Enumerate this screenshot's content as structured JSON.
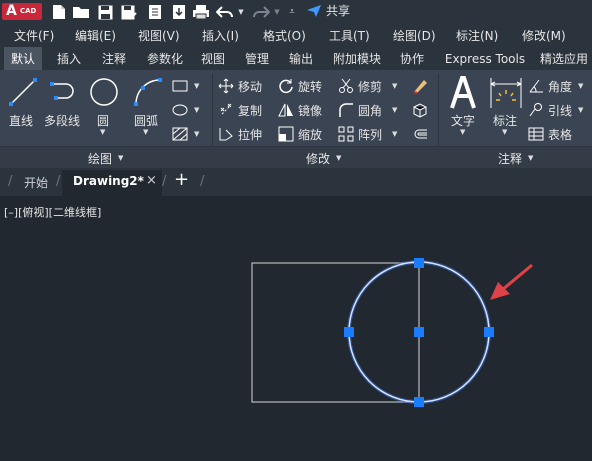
{
  "app": {
    "logo_letter": "A",
    "logo_sub": "CAD",
    "share_label": "共享"
  },
  "menu": [
    "文件(F)",
    "编辑(E)",
    "视图(V)",
    "插入(I)",
    "格式(O)",
    "工具(T)",
    "绘图(D)",
    "标注(N)",
    "修改(M)"
  ],
  "ribbon_tabs": [
    "默认",
    "插入",
    "注释",
    "参数化",
    "视图",
    "管理",
    "输出",
    "附加模块",
    "协作",
    "Express Tools",
    "精选应用"
  ],
  "active_tab": "默认",
  "draw_panel": {
    "title": "绘图",
    "tools": {
      "line": "直线",
      "polyline": "多段线",
      "circle": "圆",
      "arc": "圆弧"
    }
  },
  "modify_panel": {
    "title": "修改",
    "tools": {
      "move": "移动",
      "rotate": "旋转",
      "trim": "修剪",
      "copy": "复制",
      "mirror": "镜像",
      "fillet": "圆角",
      "stretch": "拉伸",
      "scale": "缩放",
      "array": "阵列"
    }
  },
  "annotation_panel": {
    "title": "注释",
    "tools": {
      "text": "文字",
      "dimension": "标注",
      "angle": "角度",
      "leader": "引线",
      "table": "表格"
    }
  },
  "doc_tabs": {
    "start": "开始",
    "drawing": "Drawing2*"
  },
  "viewport_label": "[–][俯视][二维线框]",
  "colors": {
    "accent": "#2a8cff",
    "circle_selected": "#8fb5ff",
    "background": "#212830",
    "ribbon": "#3b4452",
    "logo": "#c8283a",
    "arrow": "#e0424a"
  }
}
